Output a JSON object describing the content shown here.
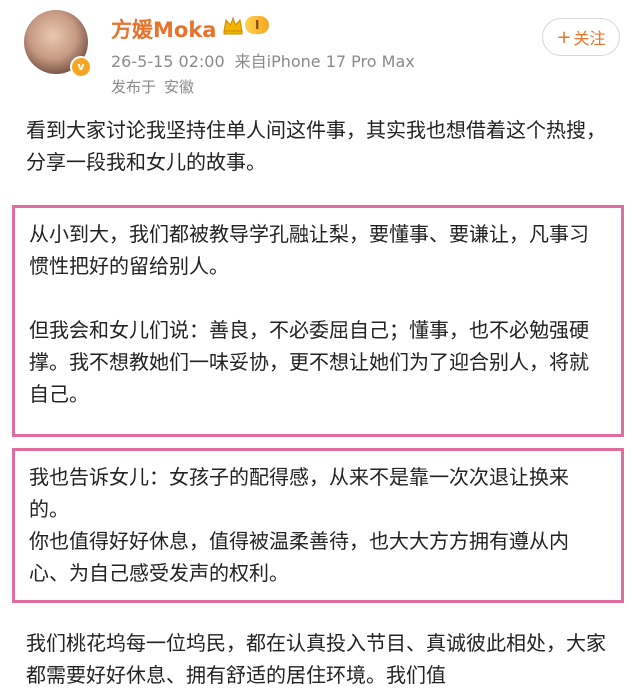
{
  "post": {
    "author": {
      "name": "方媛Moka",
      "vip_level": "I",
      "verified_badge": "v"
    },
    "meta": {
      "timestamp": "26-5-15 02:00",
      "source": "来自iPhone 17 Pro Max",
      "location_label": "发布于",
      "location": "安徽"
    },
    "follow_label": "关注",
    "follow_plus": "+",
    "paragraphs": {
      "intro": "看到大家讨论我坚持住单人间这件事，其实我也想借着这个热搜，分享一段我和女儿的故事。",
      "box1_p1": "从小到大，我们都被教导学孔融让梨，要懂事、要谦让，凡事习惯性把好的留给别人。",
      "box1_p2": "但我会和女儿们说：善良，不必委屈自己；懂事，也不必勉强硬撑。我不想教她们一味妥协，更不想让她们为了迎合别人，将就自己。",
      "box2_p1": "我也告诉女儿：女孩子的配得感，从来不是靠一次次退让换来的。",
      "box2_p2": "你也值得好好休息，值得被温柔善待，也大大方方拥有遵从内心、为自己感受发声的权利。",
      "closing": "我们桃花坞每一位坞民，都在认真投入节目、真诚彼此相处，大家都需要好好休息、拥有舒适的居住环境。我们值"
    }
  },
  "colors": {
    "accent": "#e8732b",
    "highlight_border": "#e06da0",
    "meta_text": "#8a8a8a",
    "body_text": "#222222"
  },
  "icons": {
    "vip": "crown-icon",
    "verified": "verified-v-icon"
  }
}
